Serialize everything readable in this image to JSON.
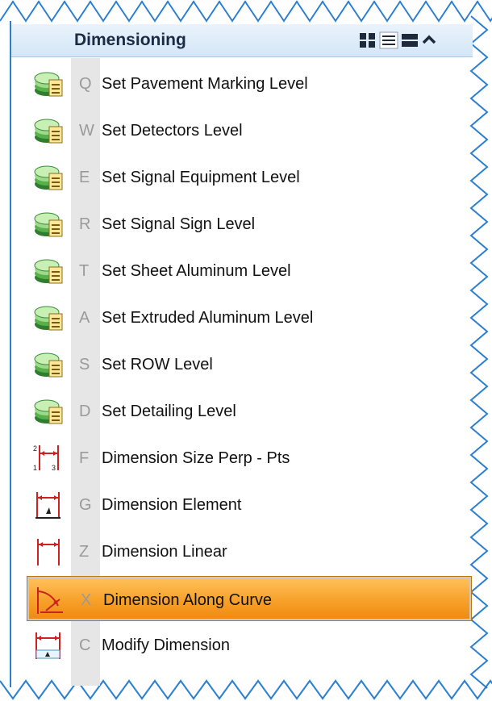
{
  "panel": {
    "title": "Dimensioning",
    "header_buttons": [
      {
        "name": "grid-view-icon"
      },
      {
        "name": "list-view-icon"
      },
      {
        "name": "detail-view-icon"
      },
      {
        "name": "collapse-icon"
      }
    ]
  },
  "items": [
    {
      "key": "Q",
      "label": "Set Pavement Marking Level",
      "icon": "level-stack-icon",
      "selected": false
    },
    {
      "key": "W",
      "label": "Set Detectors Level",
      "icon": "level-stack-icon",
      "selected": false
    },
    {
      "key": "E",
      "label": "Set Signal Equipment Level",
      "icon": "level-stack-icon",
      "selected": false
    },
    {
      "key": "R",
      "label": "Set Signal Sign Level",
      "icon": "level-stack-icon",
      "selected": false
    },
    {
      "key": "T",
      "label": "Set Sheet Aluminum Level",
      "icon": "level-stack-icon",
      "selected": false
    },
    {
      "key": "A",
      "label": "Set Extruded Aluminum Level",
      "icon": "level-stack-icon",
      "selected": false
    },
    {
      "key": "S",
      "label": "Set ROW Level",
      "icon": "level-stack-icon",
      "selected": false
    },
    {
      "key": "D",
      "label": "Set Detailing Level",
      "icon": "level-stack-icon",
      "selected": false
    },
    {
      "key": "F",
      "label": "Dimension Size Perp - Pts",
      "icon": "dimension-size-perp-icon",
      "selected": false
    },
    {
      "key": "G",
      "label": "Dimension Element",
      "icon": "dimension-element-icon",
      "selected": false
    },
    {
      "key": "Z",
      "label": "Dimension Linear",
      "icon": "dimension-linear-icon",
      "selected": false
    },
    {
      "key": "X",
      "label": "Dimension Along Curve",
      "icon": "dimension-along-curve-icon",
      "selected": true
    },
    {
      "key": "C",
      "label": "Modify Dimension",
      "icon": "modify-dimension-icon",
      "selected": false
    }
  ],
  "colors": {
    "border": "#2b7fd0",
    "selected": "#f7a12a",
    "dimension": "#cc2222"
  }
}
